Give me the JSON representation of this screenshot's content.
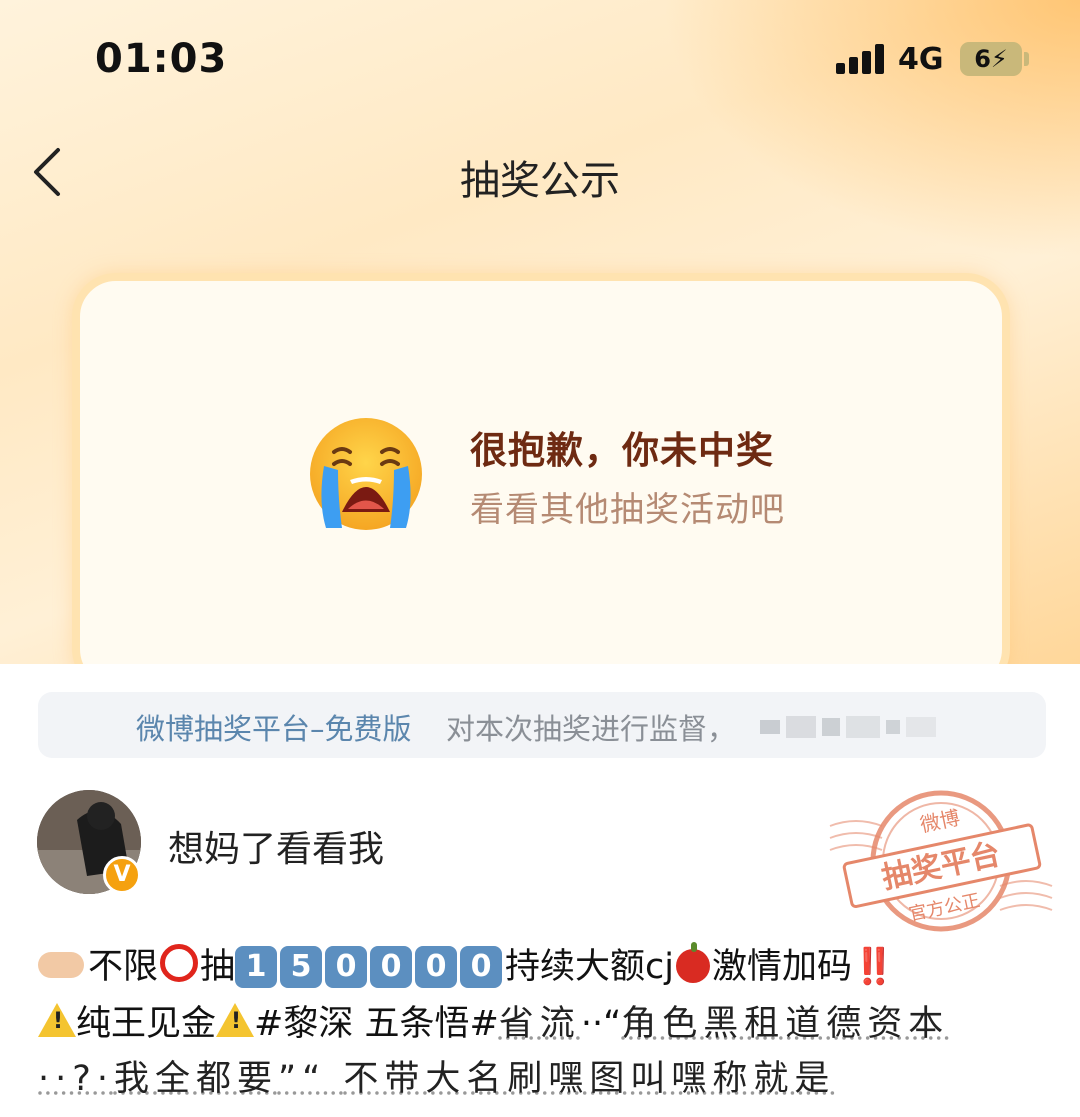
{
  "status_bar": {
    "time": "01:03",
    "network": "4G",
    "battery": "6"
  },
  "nav": {
    "title": "抽奖公示"
  },
  "result": {
    "title": "很抱歉，你未中奖",
    "subtitle": "看看其他抽奖活动吧"
  },
  "notice": {
    "platform_link": "微博抽奖平台–免费版",
    "text": "对本次抽奖进行监督，"
  },
  "user": {
    "name": "想妈了看看我",
    "verified_mark": "V"
  },
  "stamp": {
    "top": "微博",
    "middle": "抽奖平台",
    "bottom": "官方公正"
  },
  "post": {
    "line1_a": "不限",
    "line1_b": "抽",
    "line1_digits": [
      "1",
      "5",
      "0",
      "0",
      "0",
      "0"
    ],
    "line1_c": "持续大额cj",
    "line1_d": "激情加码",
    "line1_e": "‼️",
    "line2_a": "纯王见金",
    "line2_b": "#黎深 五条悟#",
    "line2_c": "省流",
    "line2_d": "角色黑租道德资本",
    "line3_a": "我全都要",
    "line3_b": "不带大名刷嘿图叫嘿称就是"
  }
}
